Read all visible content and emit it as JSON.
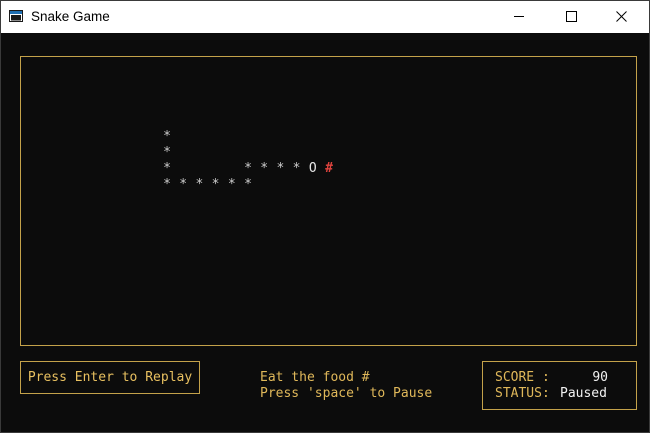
{
  "window": {
    "title": "Snake Game",
    "icon": "console-window-icon",
    "buttons": {
      "minimize": "minimize-icon",
      "maximize": "maximize-icon",
      "close": "close-icon"
    }
  },
  "game": {
    "snake_body_char": "*",
    "snake_head_char": "O",
    "food_char": "#",
    "colors": {
      "border": "#c4a24a",
      "text_accent": "#e0b85a",
      "snake": "#cfcfcf",
      "food": "#e0443e",
      "background": "#0c0c0c"
    },
    "snake_cells": [
      {
        "col": 0,
        "row": 0,
        "type": "body"
      },
      {
        "col": 0,
        "row": 1,
        "type": "body"
      },
      {
        "col": 0,
        "row": 2,
        "type": "body"
      },
      {
        "col": 0,
        "row": 3,
        "type": "body"
      },
      {
        "col": 1,
        "row": 3,
        "type": "body"
      },
      {
        "col": 2,
        "row": 3,
        "type": "body"
      },
      {
        "col": 3,
        "row": 3,
        "type": "body"
      },
      {
        "col": 4,
        "row": 3,
        "type": "body"
      },
      {
        "col": 5,
        "row": 3,
        "type": "body"
      },
      {
        "col": 5,
        "row": 2,
        "type": "body"
      },
      {
        "col": 6,
        "row": 2,
        "type": "body"
      },
      {
        "col": 7,
        "row": 2,
        "type": "body"
      },
      {
        "col": 8,
        "row": 2,
        "type": "body"
      },
      {
        "col": 9,
        "row": 2,
        "type": "head"
      }
    ],
    "food_cell": {
      "col": 10,
      "row": 2
    }
  },
  "footer": {
    "replay_label": "Press Enter to Replay",
    "hint_food": "Eat the food #",
    "hint_pause": "Press 'space' to Pause",
    "score_label": "SCORE :",
    "score_value": "90",
    "status_label": "STATUS:",
    "status_value": "Paused"
  }
}
